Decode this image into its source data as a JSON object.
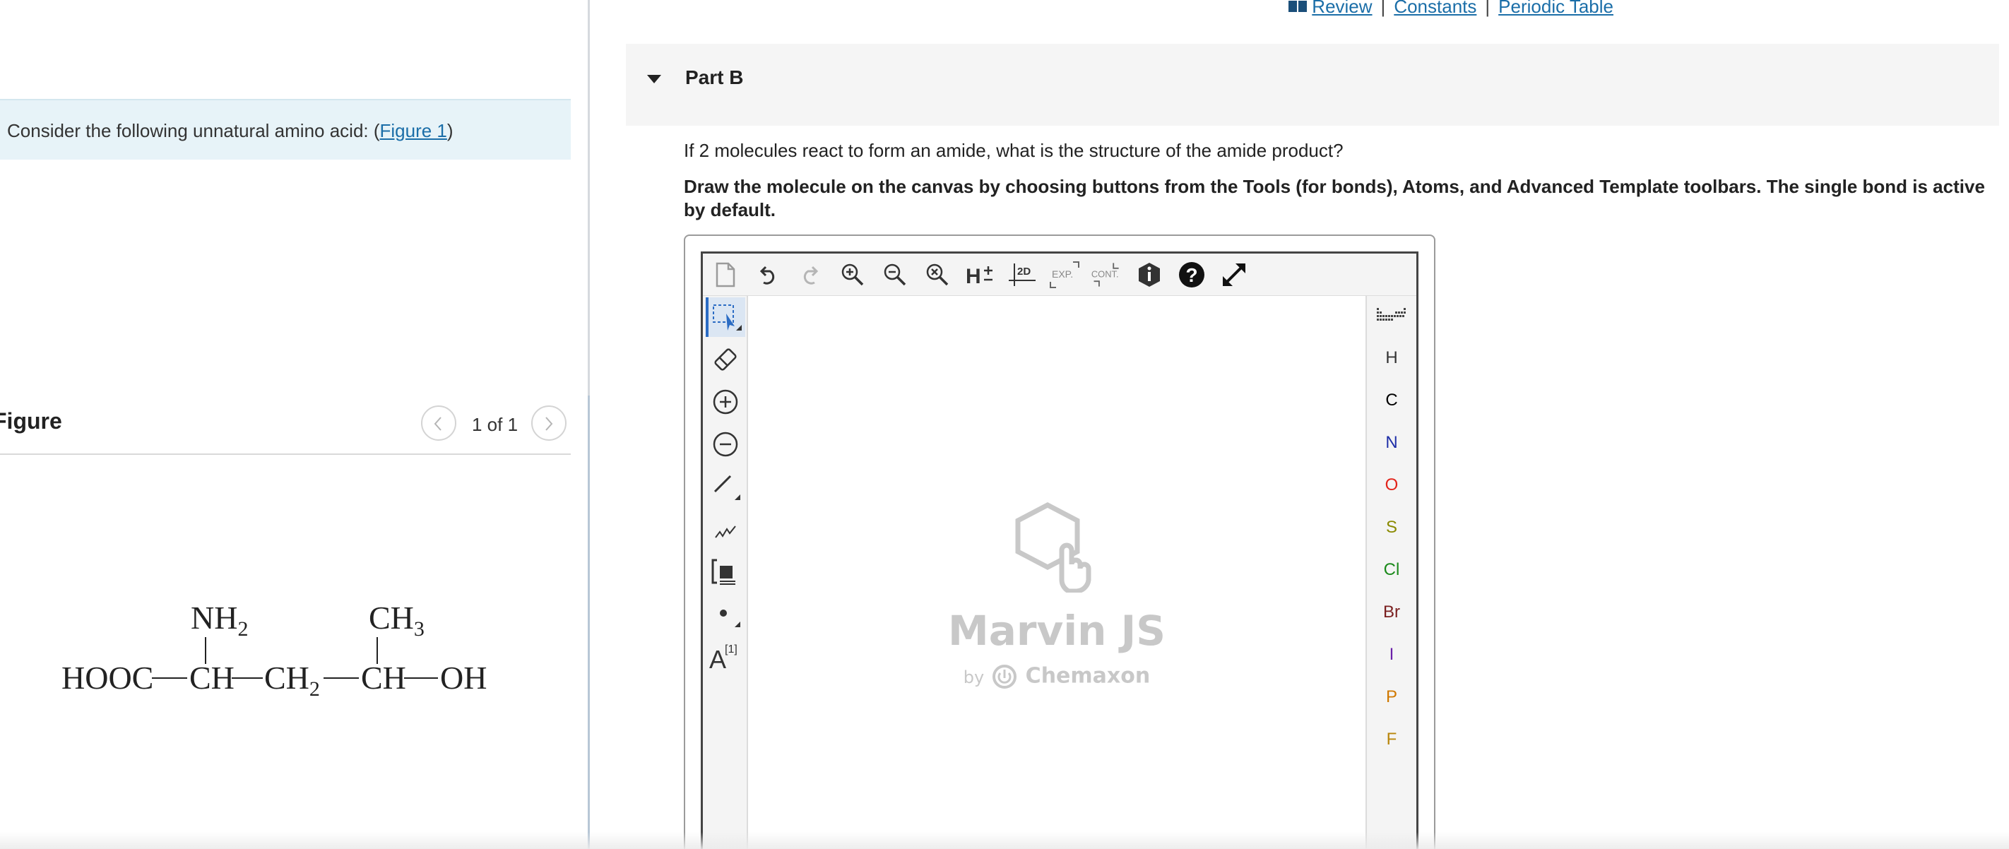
{
  "top_links": {
    "review": "Review",
    "separator": "|",
    "constants": "Constants",
    "periodic_table": "Periodic Table"
  },
  "left": {
    "intro_prefix": "Consider the following unnatural amino acid: (",
    "intro_link": "Figure 1",
    "intro_suffix": ")",
    "figure_title": "Figure",
    "figure_counter": "1 of 1",
    "molecule": {
      "nh2": "NH",
      "nh2_sub": "2",
      "ch3": "CH",
      "ch3_sub": "3",
      "hooc": "HOOC",
      "ch_1": "CH",
      "ch2": "CH",
      "ch2_sub": "2",
      "ch_2": "CH",
      "oh": "OH"
    }
  },
  "part": {
    "title": "Part B",
    "question": "If 2 molecules react to form an amide, what is the structure of the amide product?",
    "instructions": "Draw the molecule on the canvas by choosing buttons from the Tools (for bonds), Atoms, and Advanced Template toolbars. The single bond is active by default."
  },
  "editor": {
    "top_tools": [
      "new-document-icon",
      "undo-icon",
      "redo-icon",
      "zoom-in-icon",
      "zoom-out-icon",
      "zoom-fit-icon",
      "hydrogen-toggle-icon",
      "clean-2d-icon",
      "expand-icon",
      "contract-icon",
      "info-icon",
      "help-icon",
      "fullscreen-icon"
    ],
    "h_label": "H",
    "clean2d_label": "2D",
    "exp_label": "EXP.",
    "cont_label": "CONT.",
    "atoms": [
      {
        "symbol": "H",
        "color": "#333333"
      },
      {
        "symbol": "C",
        "color": "#000000"
      },
      {
        "symbol": "N",
        "color": "#1f2fa8"
      },
      {
        "symbol": "O",
        "color": "#e2231a"
      },
      {
        "symbol": "S",
        "color": "#8a8a00"
      },
      {
        "symbol": "Cl",
        "color": "#1b8a1b"
      },
      {
        "symbol": "Br",
        "color": "#7a1f1f"
      },
      {
        "symbol": "I",
        "color": "#6a1fa8"
      },
      {
        "symbol": "P",
        "color": "#d07800"
      },
      {
        "symbol": "F",
        "color": "#b8860b"
      }
    ],
    "text_tool_label": "A",
    "text_tool_sup": "[1]",
    "watermark_title": "Marvin JS",
    "watermark_by": "by",
    "watermark_brand": "Chemaxon"
  },
  "colors": {
    "link": "#1b6ea8",
    "intro_bg": "#e7f3f8",
    "part_header_bg": "#f5f5f5",
    "active_tool": "#2b6cc4"
  }
}
